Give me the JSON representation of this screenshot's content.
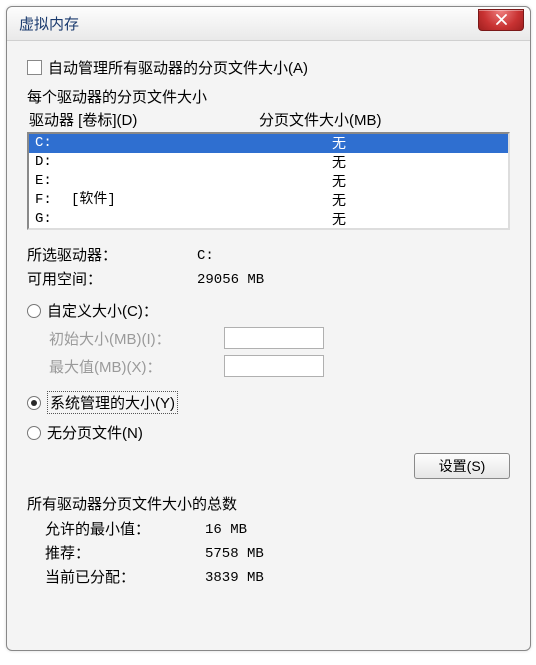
{
  "title": "虚拟内存",
  "checkbox_label": "自动管理所有驱动器的分页文件大小(A)",
  "checkbox_hotkey": "A",
  "subheader": "每个驱动器的分页文件大小",
  "columns": {
    "drive": "驱动器 [卷标](D)",
    "size": "分页文件大小(MB)"
  },
  "drives": [
    {
      "letter": "C:",
      "label": "",
      "size": "无",
      "selected": true
    },
    {
      "letter": "D:",
      "label": "",
      "size": "无",
      "selected": false
    },
    {
      "letter": "E:",
      "label": "",
      "size": "无",
      "selected": false
    },
    {
      "letter": "F:",
      "label": "[软件]",
      "size": "无",
      "selected": false
    },
    {
      "letter": "G:",
      "label": "",
      "size": "无",
      "selected": false
    }
  ],
  "selected": {
    "drive_label": "所选驱动器：",
    "drive_value": "C:",
    "space_label": "可用空间：",
    "space_value": "29056 MB"
  },
  "radios": {
    "custom": "自定义大小(C)：",
    "system": "系统管理的大小(Y)",
    "none": "无分页文件(N)",
    "selected": "system"
  },
  "custom_fields": {
    "initial_label": "初始大小(MB)(I)：",
    "max_label": "最大值(MB)(X)："
  },
  "set_button": "设置(S)",
  "summary": {
    "title": "所有驱动器分页文件大小的总数",
    "min_label": "允许的最小值：",
    "min_value": "16 MB",
    "recommend_label": "推荐：",
    "recommend_value": "5758 MB",
    "current_label": "当前已分配：",
    "current_value": "3839 MB"
  }
}
